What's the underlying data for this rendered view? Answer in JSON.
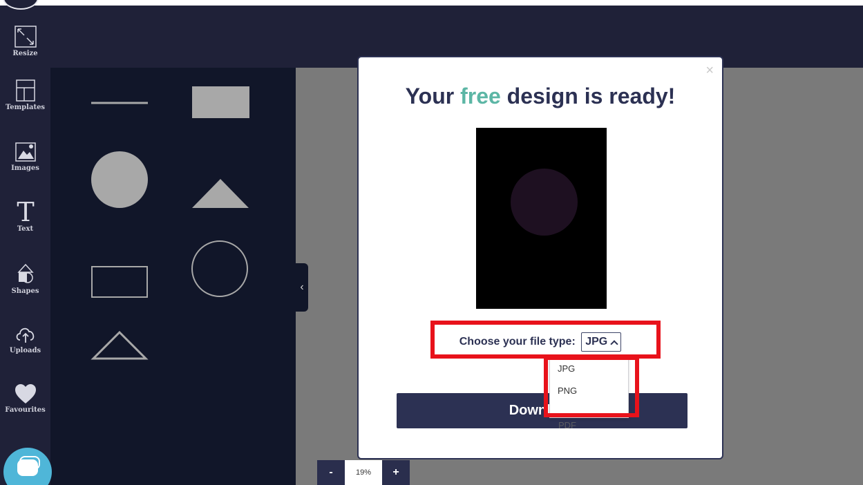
{
  "sidebar": {
    "items": [
      {
        "label": "Resize",
        "icon": "resize-icon"
      },
      {
        "label": "Templates",
        "icon": "templates-icon"
      },
      {
        "label": "Images",
        "icon": "images-icon"
      },
      {
        "label": "Text",
        "icon": "text-icon"
      },
      {
        "label": "Shapes",
        "icon": "shapes-icon"
      },
      {
        "label": "Uploads",
        "icon": "uploads-icon"
      },
      {
        "label": "Favourites",
        "icon": "heart-icon"
      }
    ]
  },
  "panel": {
    "shapes": [
      "line",
      "rectangle-filled",
      "circle-filled",
      "triangle-filled",
      "rectangle-outline",
      "circle-outline",
      "triangle-outline"
    ]
  },
  "zoom": {
    "minus_label": "-",
    "value": "19%",
    "plus_label": "+"
  },
  "modal": {
    "title_before": "Your ",
    "title_accent": "free",
    "title_after": " design is ready!",
    "close_label": "×",
    "file_type_label": "Choose your file type:",
    "file_type_selected": "JPG",
    "download_label": "Download",
    "file_type_options": [
      "JPG",
      "PNG",
      "PDF"
    ]
  },
  "colors": {
    "nav_bg": "#1f2138",
    "panel_bg": "#111629",
    "canvas_bg": "#7a7a7a",
    "modal_title": "#2c3153",
    "accent": "#5cb6a5",
    "button_bg": "#2c3153",
    "highlight": "#e8121b"
  }
}
